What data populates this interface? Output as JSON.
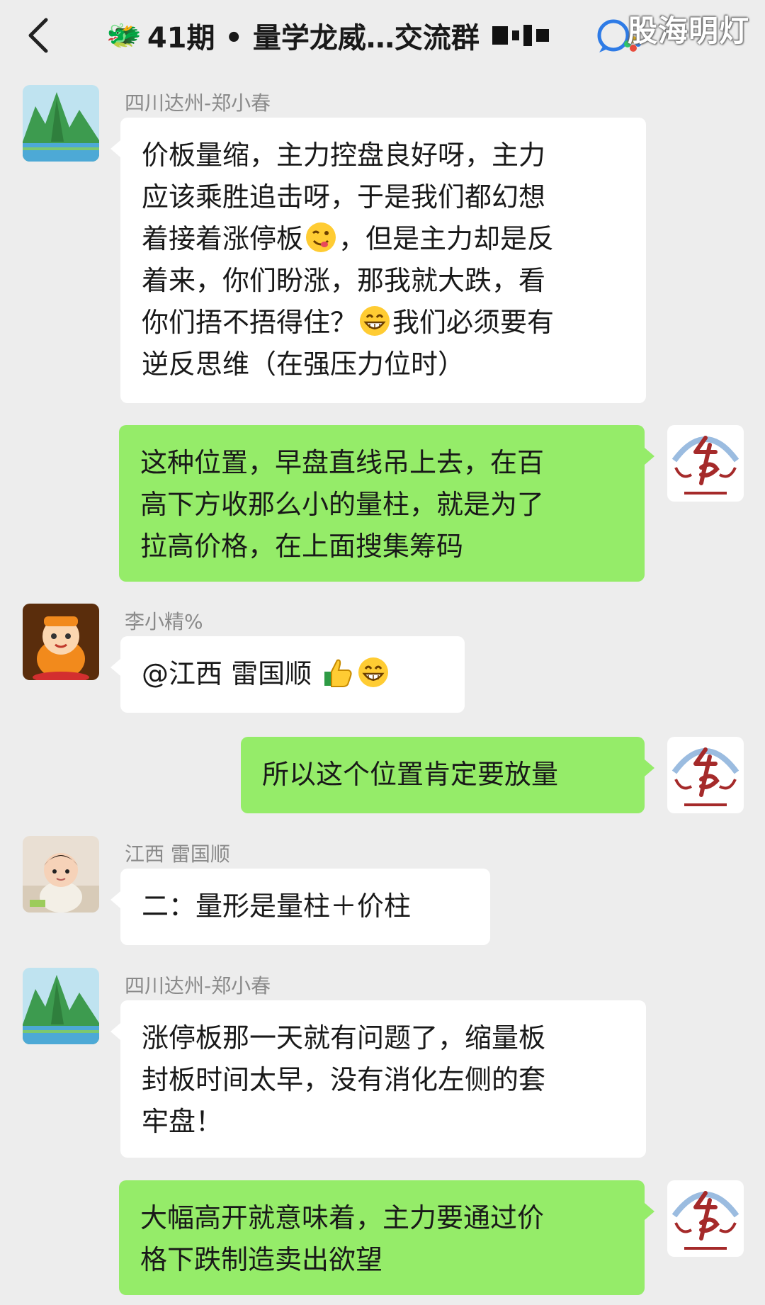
{
  "header": {
    "title_emoji": "🐲",
    "title": "41期 • 量学龙威…交流群",
    "watermark": "股海明灯"
  },
  "messages": [
    {
      "sender": "四川达州-郑小春",
      "lines": [
        "价板量缩，主力控盘良好呀，主力",
        "应该乘胜追击呀，于是我们都幻想",
        "着接着涨停板",
        "，但是主力却是反",
        "着来，你们盼涨，那我就大跌，看",
        "你们捂不捂得住？",
        "我们必须要有",
        "逆反思维（在强压力位时）"
      ],
      "emojis": [
        "wink-tongue-emoji",
        "grin-emoji"
      ]
    },
    {
      "lines": [
        "这种位置，早盘直线吊上去，在百",
        "高下方收那么小的量柱，就是为了",
        "拉高价格，在上面搜集筹码"
      ]
    },
    {
      "sender": "李小精%",
      "lines": [
        "@江西  雷国顺 "
      ],
      "emojis": [
        "thumbs-up-emoji",
        "grin-emoji"
      ]
    },
    {
      "lines": [
        "所以这个位置肯定要放量"
      ]
    },
    {
      "sender": "江西  雷国顺",
      "lines": [
        "二：量形是量柱＋价柱"
      ]
    },
    {
      "sender": "四川达州-郑小春",
      "lines": [
        "涨停板那一天就有问题了，缩量板",
        "封板时间太早，没有消化左侧的套",
        "牢盘！"
      ]
    },
    {
      "lines": [
        "大幅高开就意味着，主力要通过价",
        "格下跌制造卖出欲望"
      ]
    }
  ],
  "colors": {
    "background": "#ededed",
    "bubble_received": "#ffffff",
    "bubble_sent": "#95ec69",
    "sender_name": "#8a8a8a",
    "text": "#191919",
    "emblem_red": "#a52a2a",
    "emblem_blue": "#9bbce0"
  }
}
